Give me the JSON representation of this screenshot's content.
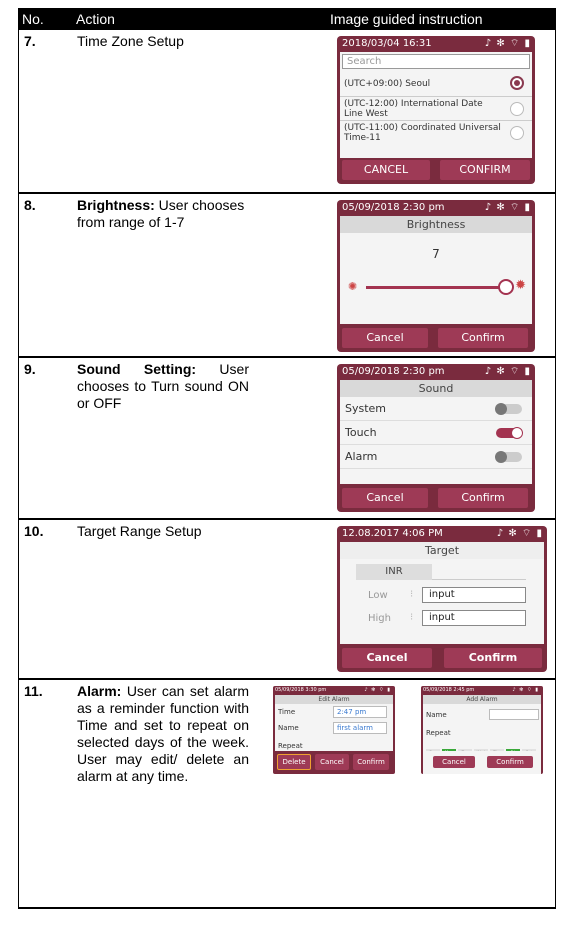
{
  "header": {
    "no": "No.",
    "action": "Action",
    "image": "Image guided instruction"
  },
  "rows": [
    {
      "no": "7.",
      "bold": "",
      "text": "Time Zone Setup"
    },
    {
      "no": "8.",
      "bold": "Brightness:",
      "text": " User chooses from range of 1-7"
    },
    {
      "no": "9.",
      "bold": "Sound Setting:",
      "text": " User chooses to Turn sound ON or OFF"
    },
    {
      "no": "10.",
      "bold": "",
      "text": "Target Range Setup"
    },
    {
      "no": "11.",
      "bold": "Alarm:",
      "text": " User can set alarm as a reminder function with Time and set to repeat on selected days of the week. User may edit/ delete an alarm at any time."
    }
  ],
  "tz": {
    "status": "2018/03/04 16:31",
    "search": "Search",
    "options": [
      "(UTC+09:00) Seoul",
      "(UTC-12:00) International Date Line West",
      "(UTC-11:00) Coordinated Universal Time-11"
    ],
    "selected": 0,
    "cancel": "CANCEL",
    "confirm": "CONFIRM"
  },
  "brightness": {
    "status": "05/09/2018 2:30 pm",
    "title": "Brightness",
    "value": "7",
    "level": 1.0,
    "cancel": "Cancel",
    "confirm": "Confirm"
  },
  "sound": {
    "status": "05/09/2018 2:30 pm",
    "title": "Sound",
    "items": [
      {
        "label": "System",
        "on": false
      },
      {
        "label": "Touch",
        "on": true
      },
      {
        "label": "Alarm",
        "on": false
      }
    ],
    "cancel": "Cancel",
    "confirm": "Confirm"
  },
  "target": {
    "status": "12.08.2017  4:06 PM",
    "title": "Target",
    "tab": "INR",
    "low_label": "Low",
    "high_label": "High",
    "low_value": "input",
    "high_value": "input",
    "cancel": "Cancel",
    "confirm": "Confirm"
  },
  "edit_alarm": {
    "status": "05/09/2018 3:30 pm",
    "title": "Edit Alarm",
    "time_label": "Time",
    "time_value": "2:47 pm",
    "name_label": "Name",
    "name_value": "first alarm",
    "repeat_label": "Repeat",
    "delete": "Delete",
    "cancel": "Cancel",
    "confirm": "Confirm"
  },
  "add_alarm": {
    "status": "05/09/2018 2:45 pm",
    "title": "Add Alarm",
    "name_label": "Name",
    "repeat_label": "Repeat",
    "days": [
      "Sun",
      "Mon",
      "Tue",
      "Wed",
      "Thu",
      "Fri",
      "Sat"
    ],
    "selected_days": [
      1,
      5
    ],
    "cancel": "Cancel",
    "confirm": "Confirm"
  }
}
